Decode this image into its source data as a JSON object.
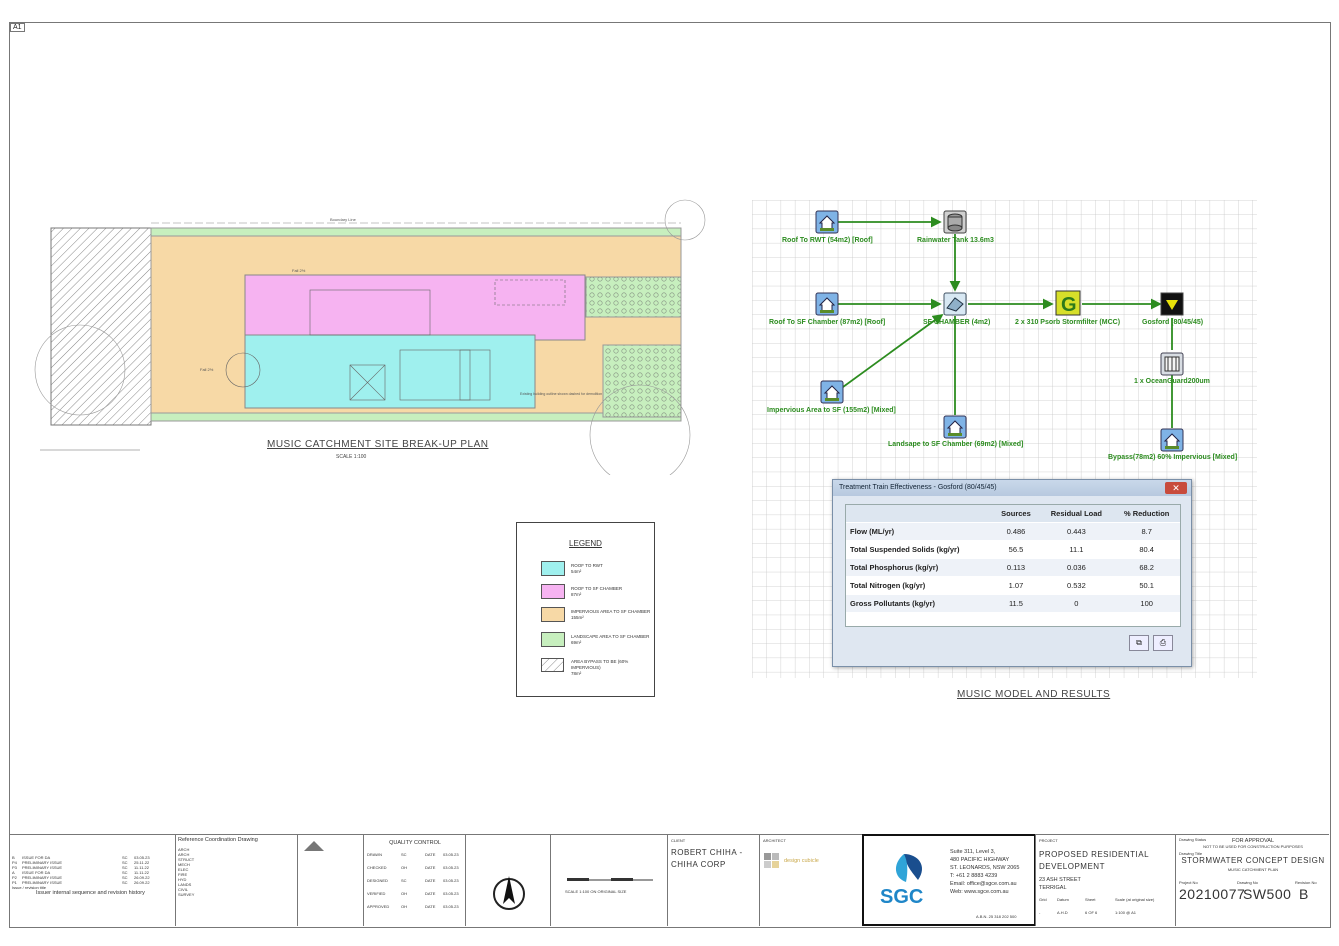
{
  "sheet": {
    "size_tag": "A1"
  },
  "site_plan": {
    "caption": "MUSIC CATCHMENT SITE BREAK-UP PLAN",
    "scale": "SCALE 1:100",
    "boundary_label": "Boundary Line",
    "notes": [
      "Fall 2%",
      "Fall 2%",
      "Existing building outline shown dashed for demolition"
    ]
  },
  "legend": {
    "title": "LEGEND",
    "items": [
      {
        "label": "ROOF TO RWT",
        "area": "54m²",
        "color": "#9ff0ee"
      },
      {
        "label": "ROOF TO SF CHAMBER",
        "area": "87m²",
        "color": "#f6b3f1"
      },
      {
        "label": "IMPERVIOUS AREA TO SF CHAMBER",
        "area": "155m²",
        "color": "#f7d9a6"
      },
      {
        "label": "LANDSCAPE AREA TO SF CHAMBER",
        "area": "69m²",
        "color": "#c7efbe"
      },
      {
        "label": "AREA BYPASS TO BE (60% IMPERVIOUS)",
        "area": "78m²",
        "color": "hatch"
      }
    ]
  },
  "music_model": {
    "caption": "MUSIC MODEL AND RESULTS",
    "nodes": {
      "roof_rwt": "Roof To RWT (54m2) [Roof]",
      "rainwater_tank": "Rainwater Tank 13.6m3",
      "roof_sf": "Roof To SF Chamber (87m2) [Roof]",
      "sf_chamber": "SF CHAMBER (4m2)",
      "stormfilter": "2 x 310 Psorb Stormfilter (MCC)",
      "gosford": "Gosford (80/45/45)",
      "oceanguard": "1 x OceanGuard200um",
      "impervious": "Impervious Area to SF (155m2) [Mixed]",
      "landscape": "Landsape to SF Chamber (69m2) [Mixed]",
      "bypass": "Bypass(78m2) 60% Impervious [Mixed]"
    }
  },
  "results_dialog": {
    "title": "Treatment Train Effectiveness - Gosford (80/45/45)",
    "headers": [
      "",
      "Sources",
      "Residual Load",
      "% Reduction"
    ],
    "rows": [
      [
        "Flow (ML/yr)",
        "0.486",
        "0.443",
        "8.7"
      ],
      [
        "Total Suspended Solids (kg/yr)",
        "56.5",
        "11.1",
        "80.4"
      ],
      [
        "Total Phosphorus (kg/yr)",
        "0.113",
        "0.036",
        "68.2"
      ],
      [
        "Total Nitrogen (kg/yr)",
        "1.07",
        "0.532",
        "50.1"
      ],
      [
        "Gross Pollutants (kg/yr)",
        "11.5",
        "0",
        "100"
      ]
    ]
  },
  "title_block": {
    "revisions": [
      [
        "B",
        "ISSUE FOR DA",
        "SC",
        "03.05.23"
      ],
      [
        "P4",
        "PRELIMINARY ISSUE",
        "SC",
        "25.11.22"
      ],
      [
        "P3",
        "PRELIMINARY ISSUE",
        "SC",
        "11.11.22"
      ],
      [
        "A",
        "ISSUE FOR DA",
        "SC",
        "11.11.22"
      ],
      [
        "P2",
        "PRELIMINARY ISSUE",
        "SC",
        "26.09.22"
      ],
      [
        "P1",
        "PRELIMINARY ISSUE",
        "SC",
        "26.09.22"
      ]
    ],
    "revision_header": "Issue / revision title",
    "issue_history": "Issuer internal sequence and revision history",
    "ref_drawing_header": "Reference Coordination Drawing",
    "disciplines": [
      "ARCH",
      "ARCH",
      "STRUCT",
      "MECH",
      "ELEC",
      "FIRE",
      "HYD",
      "LANDS",
      "CIVIL",
      "SURVEY"
    ],
    "quality_control": {
      "title": "QUALITY CONTROL",
      "rows": [
        [
          "DRAWN",
          "SC",
          "DATE",
          "03.05.23"
        ],
        [
          "CHECKED",
          "OH",
          "DATE",
          "03.05.23"
        ],
        [
          "DESIGNED",
          "SC",
          "DATE",
          "03.05.23"
        ],
        [
          "VERIFIED",
          "OH",
          "DATE",
          "03.05.23"
        ],
        [
          "APPROVED",
          "OH",
          "DATE",
          "03.05.23"
        ]
      ]
    },
    "scale_note": "SCALE 1:100 ON ORIGINAL SIZE",
    "client_label": "CLIENT",
    "client": "ROBERT CHIHA - CHIHA CORP",
    "architect_label": "ARCHITECT",
    "architect": "design cubicle",
    "sgc": {
      "logo": "SGC",
      "address": [
        "Suite 311, Level 3,",
        "480 PACIFIC HIGHWAY",
        "ST. LEONARDS, NSW 2065"
      ],
      "phone": "T: +61 2 8883 4239",
      "email": "Email: office@sgce.com.au",
      "web": "Web: www.sgce.com.au",
      "abn": "A.B.N. 25 318 202 500"
    },
    "project_label": "PROJECT",
    "project": "PROPOSED RESIDENTIAL DEVELOPMENT",
    "address": "23 ASH STREET",
    "suburb": "TERRIGAL",
    "status_label": "Drawing Status",
    "status": "FOR APPROVAL",
    "status_note": "NOT TO BE USED FOR CONSTRUCTION PURPOSES",
    "title_label": "Drawing Title",
    "title": "STORMWATER CONCEPT DESIGN",
    "subtitle": "MUSIC CATCHMENT PLAN",
    "project_no_label": "Project No",
    "project_no": "20210077",
    "drawing_no_label": "Drawing No",
    "drawing_no": "SW500",
    "revision_label": "Revision No",
    "revision": "B",
    "grid_labels": [
      "Grid",
      "Datum",
      "Sheet",
      "Scale (at original size)"
    ],
    "grid_values": [
      "-",
      "A.H.D",
      "6 OF 6",
      "1:100 @ A1"
    ]
  }
}
